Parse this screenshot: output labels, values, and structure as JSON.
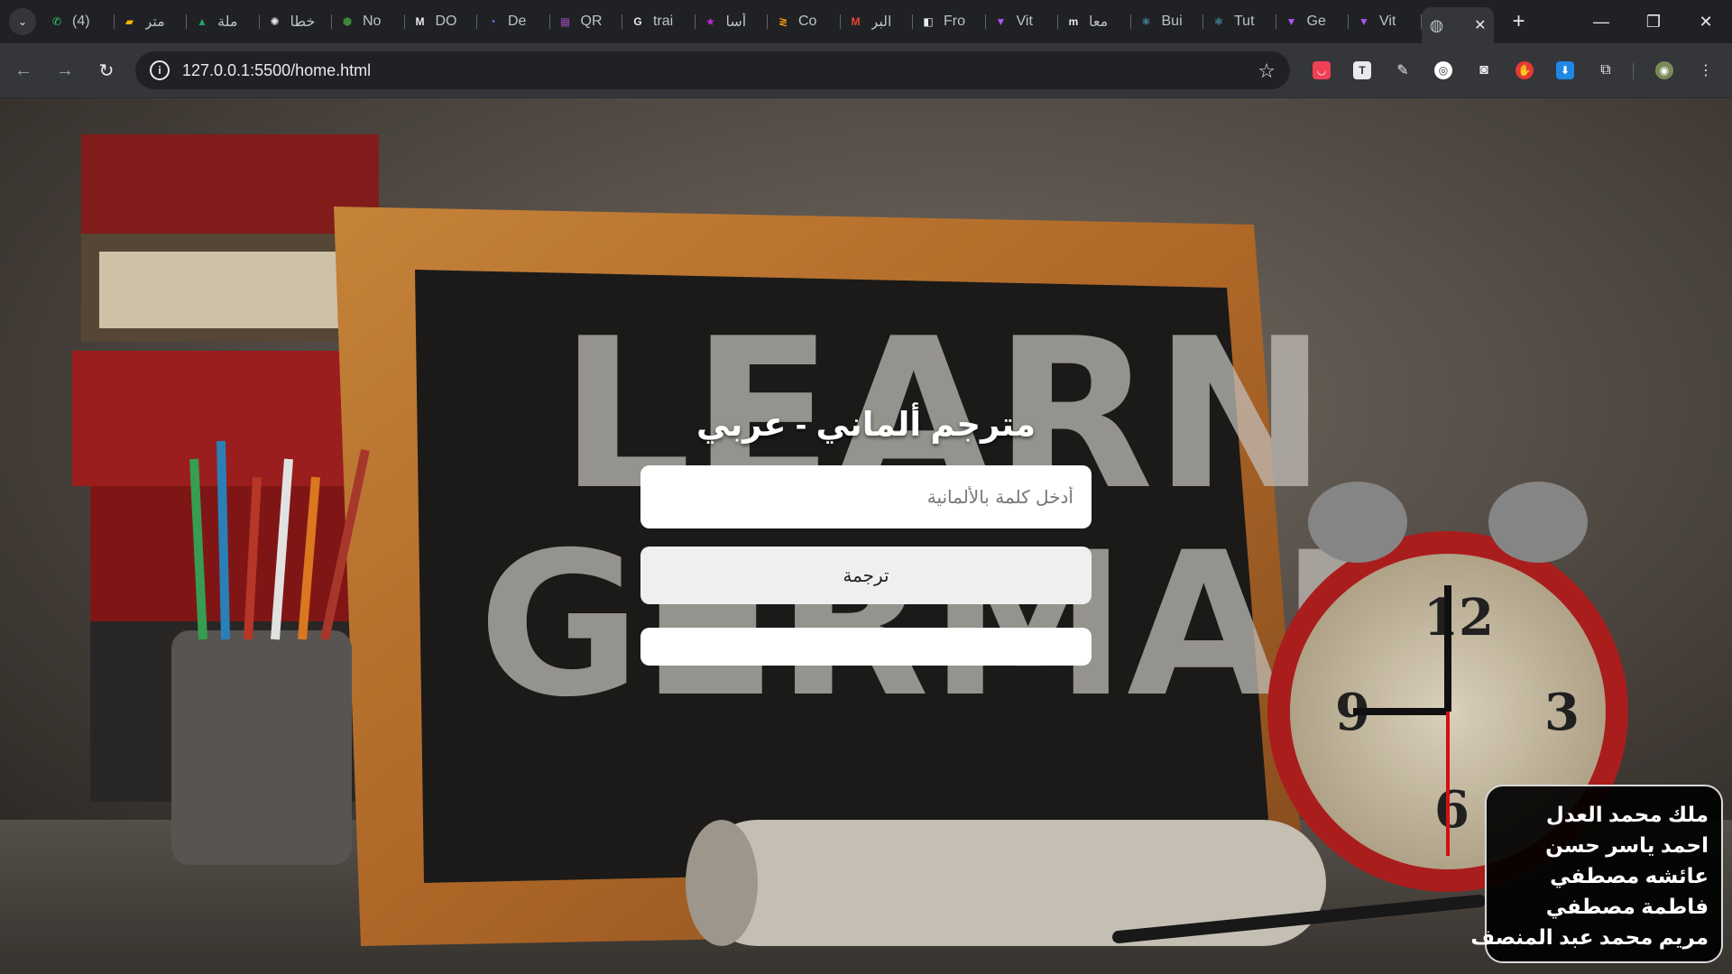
{
  "browser": {
    "tabs": [
      {
        "title": "(4)",
        "icon": "whatsapp-icon",
        "color": "#25d366",
        "glyph": "✆"
      },
      {
        "title": "متر",
        "icon": "folder-icon",
        "color": "#f4b400",
        "glyph": "▰"
      },
      {
        "title": "ملة",
        "icon": "google-drive-icon",
        "color": "#1fa463",
        "glyph": "▲"
      },
      {
        "title": "خطا",
        "icon": "openai-icon",
        "color": "#e8eaed",
        "glyph": "✺"
      },
      {
        "title": "No",
        "icon": "nodejs-icon",
        "color": "#3c873a",
        "glyph": "⬢"
      },
      {
        "title": "DO",
        "icon": "medium-icon",
        "color": "#e8eaed",
        "glyph": "M"
      },
      {
        "title": "De",
        "icon": "dev-icon",
        "color": "#6c7bff",
        "glyph": "◔"
      },
      {
        "title": "QR",
        "icon": "qr-icon",
        "color": "#8e44ad",
        "glyph": "▦"
      },
      {
        "title": "trai",
        "icon": "google-icon",
        "color": "#e8eaed",
        "glyph": "G"
      },
      {
        "title": "أسا",
        "icon": "star-icon",
        "color": "#c026d3",
        "glyph": "★"
      },
      {
        "title": "Co",
        "icon": "coursera-icon",
        "color": "#f59e0b",
        "glyph": "≷"
      },
      {
        "title": "البر",
        "icon": "gmail-icon",
        "color": "#ea4335",
        "glyph": "M"
      },
      {
        "title": "Fro",
        "icon": "frontend-icon",
        "color": "#e8eaed",
        "glyph": "◧"
      },
      {
        "title": "Vit",
        "icon": "vite-icon",
        "color": "#a855f7",
        "glyph": "▼"
      },
      {
        "title": "معا",
        "icon": "m-icon",
        "color": "#e8eaed",
        "glyph": "m"
      },
      {
        "title": "Bui",
        "icon": "react-icon",
        "color": "#61dafb",
        "glyph": "⚛"
      },
      {
        "title": "Tut",
        "icon": "react-icon",
        "color": "#61dafb",
        "glyph": "⚛"
      },
      {
        "title": "Ge",
        "icon": "vite-icon",
        "color": "#a855f7",
        "glyph": "▼"
      },
      {
        "title": "Vit",
        "icon": "vite-icon",
        "color": "#a855f7",
        "glyph": "▼"
      }
    ],
    "active_tab": {
      "icon": "globe-icon",
      "glyph": "◍"
    },
    "url": "127.0.0.1:5500/home.html"
  },
  "app": {
    "title": "مترجم ألماني - عربي",
    "input_placeholder": "أدخل كلمة بالألمانية",
    "input_value": "",
    "button_label": "ترجمة",
    "result": ""
  },
  "credits": [
    "ملك محمد العدل",
    "احمد ياسر حسن",
    "عائشه مصطفي",
    "فاطمة مصطفي",
    "مريم محمد عبد المنصف"
  ],
  "background": {
    "chalkboard_text_line1": "LEARN",
    "chalkboard_text_line2": "GERMAN",
    "clock_numbers": [
      "12",
      "3",
      "6",
      "9"
    ]
  }
}
